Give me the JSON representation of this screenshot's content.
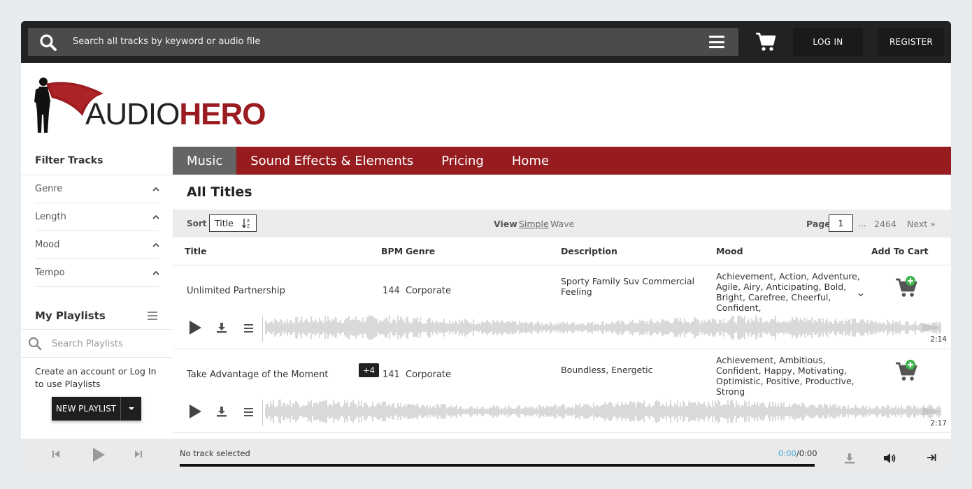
{
  "topbar": {
    "search_placeholder": "Search all tracks by keyword or audio file",
    "login_label": "LOG IN",
    "register_label": "REGISTER"
  },
  "logo": {
    "part1": "AUDIO",
    "part2": "HERO"
  },
  "sidebar": {
    "filter_title": "Filter Tracks",
    "filters": [
      {
        "label": "Genre"
      },
      {
        "label": "Length"
      },
      {
        "label": "Mood"
      },
      {
        "label": "Tempo"
      }
    ],
    "playlists_title": "My Playlists",
    "playlist_search_placeholder": "Search Playlists",
    "playlist_help": "Create an account or Log In to use Playlists",
    "new_playlist_label": "NEW PLAYLIST"
  },
  "nav": {
    "items": [
      {
        "label": "Music",
        "active": true
      },
      {
        "label": "Sound Effects & Elements"
      },
      {
        "label": "Pricing"
      },
      {
        "label": "Home"
      }
    ]
  },
  "main": {
    "heading": "All Titles",
    "sort_label": "Sort",
    "sort_value": "Title",
    "view_label": "View",
    "view_simple": "Simple",
    "view_wave": "Wave",
    "page_label": "Page",
    "page_value": "1",
    "page_dots": "...",
    "page_total": "2464",
    "next_label": "Next »",
    "columns": {
      "title": "Title",
      "bpm": "BPM",
      "genre": "Genre",
      "description": "Description",
      "mood": "Mood",
      "add_to_cart": "Add To Cart"
    },
    "tracks": [
      {
        "title": "Unlimited Partnership",
        "badge": "",
        "bpm": "144",
        "genre": "Corporate",
        "description": "Sporty Family Suv Commercial Feeling",
        "mood": "Achievement, Action, Adventure, Agile, Airy, Anticipating, Bold, Bright, Carefree, Cheerful, Confident,",
        "duration": "2:14"
      },
      {
        "title": "Take Advantage of the Moment",
        "badge": "+4",
        "bpm": "141",
        "genre": "Corporate",
        "description": "Boundless, Energetic",
        "mood": "Achievement, Ambitious, Confident, Happy, Motivating, Optimistic, Positive, Productive, Strong",
        "duration": "2:17"
      }
    ]
  },
  "player": {
    "status": "No track selected",
    "current_time": "0:00",
    "total_time": "0:00"
  },
  "colors": {
    "brand_red": "#971c1f",
    "nav_active": "#656565",
    "cart_green": "#3cb54a",
    "time_blue": "#4aa8d8"
  }
}
